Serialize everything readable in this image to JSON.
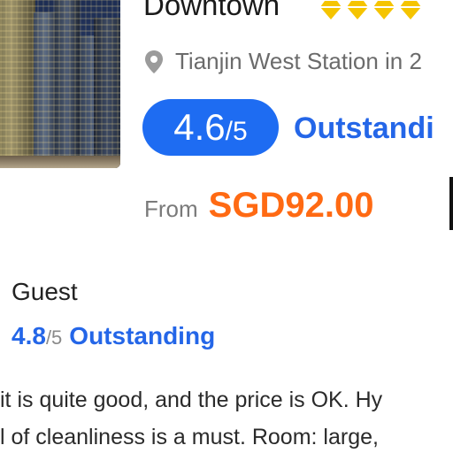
{
  "hotel": {
    "name": "Downtown",
    "star_count": 4,
    "star_color": "#f5c400",
    "location": "Tianjin West Station in 2",
    "rating": {
      "score": "4.6",
      "slash": "/",
      "scale": "5",
      "word": "Outstandi"
    },
    "price": {
      "from_label": "From",
      "amount": "SGD92.00"
    }
  },
  "guest_review": {
    "label": "Guest",
    "score": "4.8",
    "scale": "/5",
    "word": "Outstanding",
    "lines": [
      "it is quite good, and the price is OK. Hy",
      "l of cleanliness is a must. Room: large,"
    ]
  },
  "colors": {
    "accent_blue": "#1e6cf2",
    "price_orange": "#ff6a13"
  },
  "icons": {
    "location": "map-pin-icon",
    "star": "diamond-star-icon"
  }
}
